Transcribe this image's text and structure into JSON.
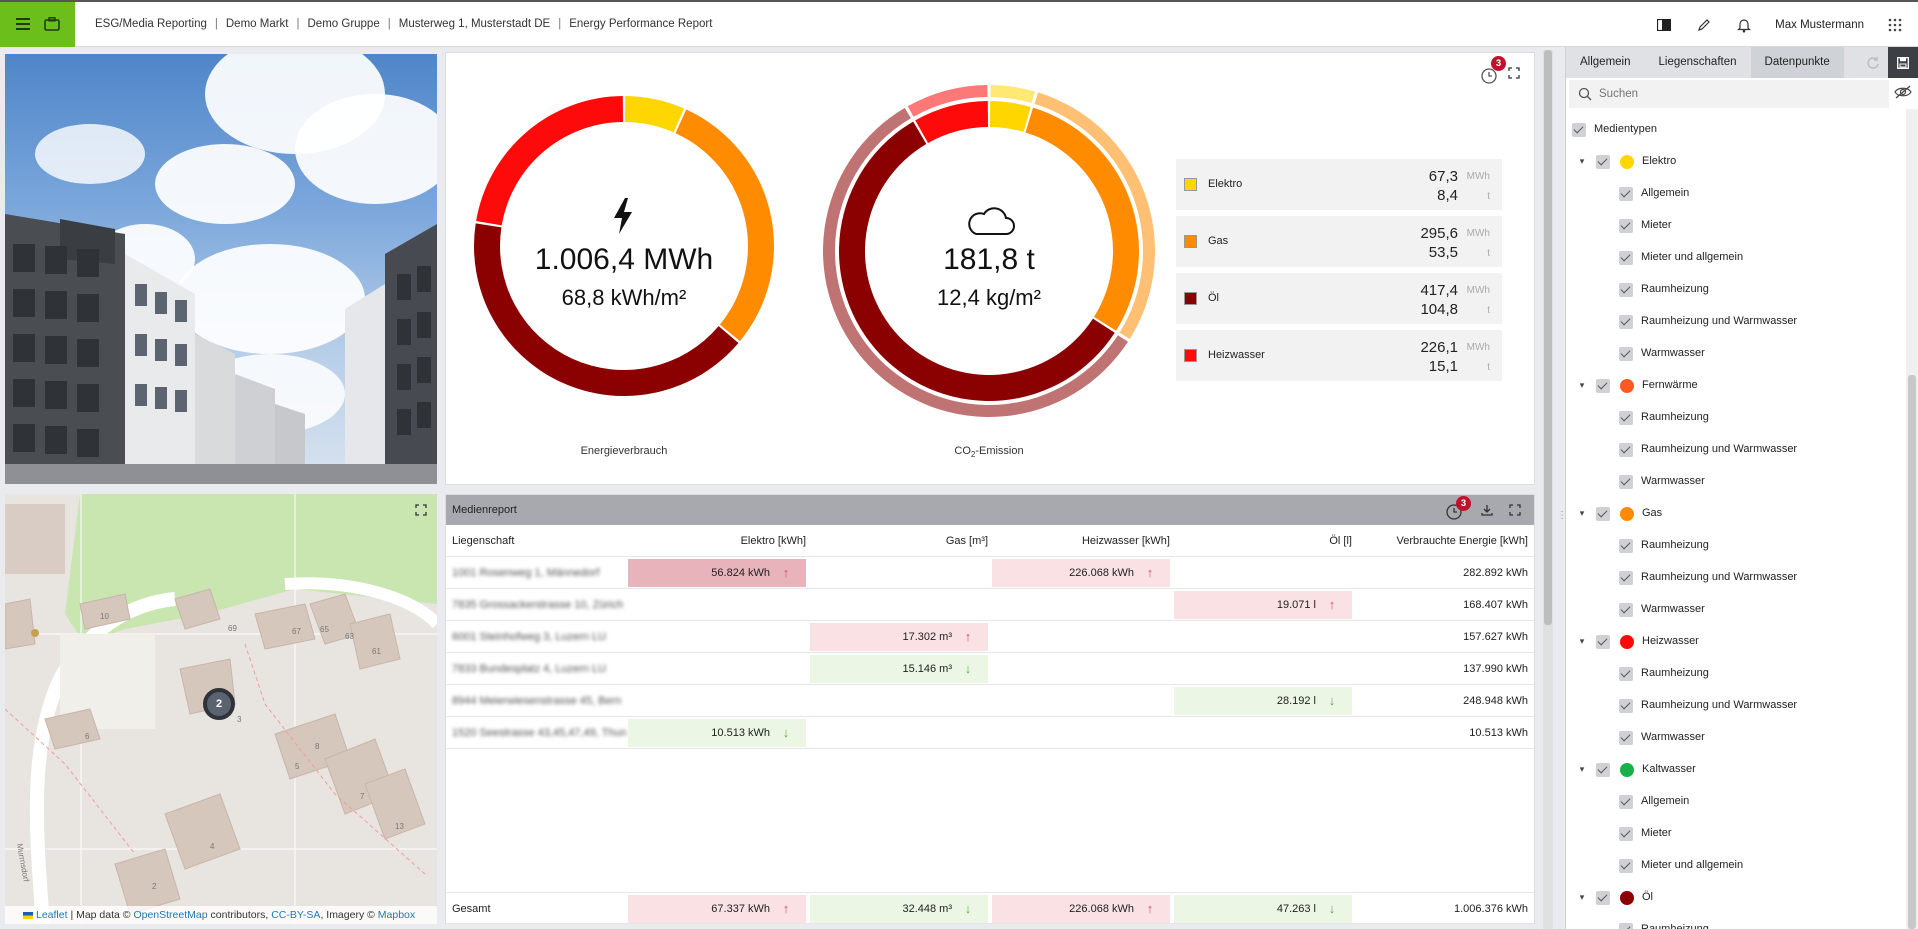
{
  "topbar": {
    "breadcrumbs": [
      "ESG/Media Reporting",
      "Demo Markt",
      "Demo Gruppe",
      "Musterweg 1, Musterstadt DE",
      "Energy Performance Report"
    ],
    "user_name": "Max Mustermann"
  },
  "map": {
    "cluster_count": "2",
    "street_label": "Murrnsdorf",
    "attribution": {
      "leaflet": "Leaflet",
      "text1": " | Map data © ",
      "osm": "OpenStreetMap",
      "text2": " contributors, ",
      "license": "CC-BY-SA",
      "text3": ", Imagery © ",
      "mapbox": "Mapbox"
    },
    "building_numbers": [
      "10",
      "69",
      "67",
      "65",
      "63",
      "61",
      "3",
      "6",
      "8",
      "5",
      "7",
      "13",
      "4",
      "2"
    ]
  },
  "chart_panel": {
    "badge": "3",
    "energy": {
      "value": "1.006,4 MWh",
      "intensity": "68,8 kWh/m²",
      "label": "Energieverbrauch"
    },
    "co2": {
      "value": "181,8 t",
      "intensity": "12,4 kg/m²",
      "label_prefix": "CO",
      "label_sub": "2",
      "label_suffix": "-Emission"
    },
    "legend": [
      {
        "name": "Elektro",
        "color": "#ffd600",
        "v1": "67,3",
        "u1": "MWh",
        "v2": "8,4",
        "u2": "t"
      },
      {
        "name": "Gas",
        "color": "#ff8c00",
        "v1": "295,6",
        "u1": "MWh",
        "v2": "53,5",
        "u2": "t"
      },
      {
        "name": "Öl",
        "color": "#8b0000",
        "v1": "417,4",
        "u1": "MWh",
        "v2": "104,8",
        "u2": "t"
      },
      {
        "name": "Heizwasser",
        "color": "#ff0a0a",
        "v1": "226,1",
        "u1": "MWh",
        "v2": "15,1",
        "u2": "t"
      }
    ]
  },
  "chart_data": [
    {
      "type": "pie",
      "title": "Energieverbrauch",
      "categories": [
        "Elektro",
        "Gas",
        "Öl",
        "Heizwasser"
      ],
      "values": [
        67.3,
        295.6,
        417.4,
        226.1
      ],
      "colors": [
        "#ffd600",
        "#ff8c00",
        "#8b0000",
        "#ff0a0a"
      ]
    },
    {
      "type": "pie",
      "title": "CO₂-Emission",
      "categories": [
        "Elektro",
        "Gas",
        "Öl",
        "Heizwasser"
      ],
      "values": [
        8.4,
        53.5,
        104.8,
        15.1
      ],
      "colors": [
        "#ffd600",
        "#ff8c00",
        "#8b0000",
        "#ff0a0a"
      ]
    }
  ],
  "table": {
    "title": "Medienreport",
    "badge": "3",
    "headers": [
      "Liegenschaft",
      "Elektro [kWh]",
      "Gas [m³]",
      "Heizwasser [kWh]",
      "Öl [l]",
      "Verbrauchte Energie [kWh]"
    ],
    "rows": [
      {
        "prop": "1001 Rosenweg 1, Männedorf",
        "cells": [
          {
            "v": "56.824 kWh",
            "t": "up strong"
          },
          null,
          {
            "v": "226.068 kWh",
            "t": "up"
          },
          null
        ],
        "total": "282.892 kWh"
      },
      {
        "prop": "7835 Grossackerstrasse 10, Zürich",
        "cells": [
          null,
          null,
          null,
          {
            "v": "19.071 l",
            "t": "up"
          }
        ],
        "total": "168.407 kWh"
      },
      {
        "prop": "6001 Steinhofweg 3, Luzern LU",
        "cells": [
          null,
          {
            "v": "17.302 m³",
            "t": "up"
          },
          null,
          null
        ],
        "total": "157.627 kWh"
      },
      {
        "prop": "7833 Bundesplatz 4, Luzern LU",
        "cells": [
          null,
          {
            "v": "15.146 m³",
            "t": "down"
          },
          null,
          null
        ],
        "total": "137.990 kWh"
      },
      {
        "prop": "8944 Meierwiesenstrasse 45, Bern",
        "cells": [
          null,
          null,
          null,
          {
            "v": "28.192 l",
            "t": "down"
          }
        ],
        "total": "248.948 kWh"
      },
      {
        "prop": "1520 Seestrasse 43,45,47,49, Thun",
        "cells": [
          {
            "v": "10.513 kWh",
            "t": "down"
          },
          null,
          null,
          null
        ],
        "total": "10.513 kWh"
      }
    ],
    "footer": {
      "label": "Gesamt",
      "cells": [
        {
          "v": "67.337 kWh",
          "t": "up"
        },
        {
          "v": "32.448 m³",
          "t": "down"
        },
        {
          "v": "226.068 kWh",
          "t": "up"
        },
        {
          "v": "47.263 l",
          "t": "down"
        }
      ],
      "total": "1.006.376 kWh"
    }
  },
  "sidebar": {
    "tabs": [
      "Allgemein",
      "Liegenschaften",
      "Datenpunkte"
    ],
    "search_placeholder": "Suchen",
    "tree": [
      {
        "level": 0,
        "label": "Medientypen"
      },
      {
        "level": 1,
        "label": "Elektro",
        "color": "#ffd600"
      },
      {
        "level": 2,
        "label": "Allgemein"
      },
      {
        "level": 2,
        "label": "Mieter"
      },
      {
        "level": 2,
        "label": "Mieter und allgemein"
      },
      {
        "level": 2,
        "label": "Raumheizung"
      },
      {
        "level": 2,
        "label": "Raumheizung und Warmwasser"
      },
      {
        "level": 2,
        "label": "Warmwasser"
      },
      {
        "level": 1,
        "label": "Fernwärme",
        "color": "#ff5a1f"
      },
      {
        "level": 2,
        "label": "Raumheizung"
      },
      {
        "level": 2,
        "label": "Raumheizung und Warmwasser"
      },
      {
        "level": 2,
        "label": "Warmwasser"
      },
      {
        "level": 1,
        "label": "Gas",
        "color": "#ff8c00"
      },
      {
        "level": 2,
        "label": "Raumheizung"
      },
      {
        "level": 2,
        "label": "Raumheizung und Warmwasser"
      },
      {
        "level": 2,
        "label": "Warmwasser"
      },
      {
        "level": 1,
        "label": "Heizwasser",
        "color": "#ff0a0a"
      },
      {
        "level": 2,
        "label": "Raumheizung"
      },
      {
        "level": 2,
        "label": "Raumheizung und Warmwasser"
      },
      {
        "level": 2,
        "label": "Warmwasser"
      },
      {
        "level": 1,
        "label": "Kaltwasser",
        "color": "#17b04a"
      },
      {
        "level": 2,
        "label": "Allgemein"
      },
      {
        "level": 2,
        "label": "Mieter"
      },
      {
        "level": 2,
        "label": "Mieter und allgemein"
      },
      {
        "level": 1,
        "label": "Öl",
        "color": "#8b0000"
      },
      {
        "level": 2,
        "label": "Raumheizung"
      }
    ]
  }
}
